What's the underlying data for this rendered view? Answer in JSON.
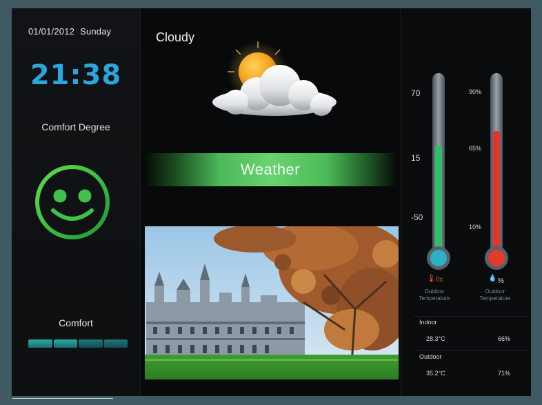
{
  "header": {
    "date": "01/01/2012",
    "weekday": "Sunday"
  },
  "clock": {
    "time": "21:38",
    "color": "#2aa6dd"
  },
  "comfort": {
    "title": "Comfort Degree",
    "status_label": "Comfort",
    "face_icon": "smiley-face-icon",
    "bar_segments": 4
  },
  "weather": {
    "condition": "Cloudy",
    "icon": "sun-behind-cloud-icon",
    "banner_label": "Weather",
    "accent": "#4fbf5d"
  },
  "thermometers": {
    "temperature": {
      "scale": [
        "70",
        "15",
        "-50"
      ],
      "level": 0.62,
      "fill_color": "#2fbf6a",
      "bulb_color": "#2bb0c8",
      "icon": "thermometer-icon",
      "unit": "0c",
      "caption": [
        "Outdoor",
        "Temperature"
      ]
    },
    "humidity": {
      "scale": [
        "90%",
        "65%",
        "10%"
      ],
      "level": 0.7,
      "fill_color": "#e2352a",
      "bulb_color": "#e43a2c",
      "icon": "water-drop-icon",
      "unit": "%",
      "caption": [
        "Outdoor",
        "Temperature"
      ]
    }
  },
  "readings": {
    "indoor": {
      "label": "Indoor",
      "temp_value": "28.3",
      "temp_unit": "°C",
      "humidity": "66%"
    },
    "outdoor": {
      "label": "Outdoor",
      "temp_value": "35.2",
      "temp_unit": "°C",
      "humidity": "71%"
    }
  }
}
